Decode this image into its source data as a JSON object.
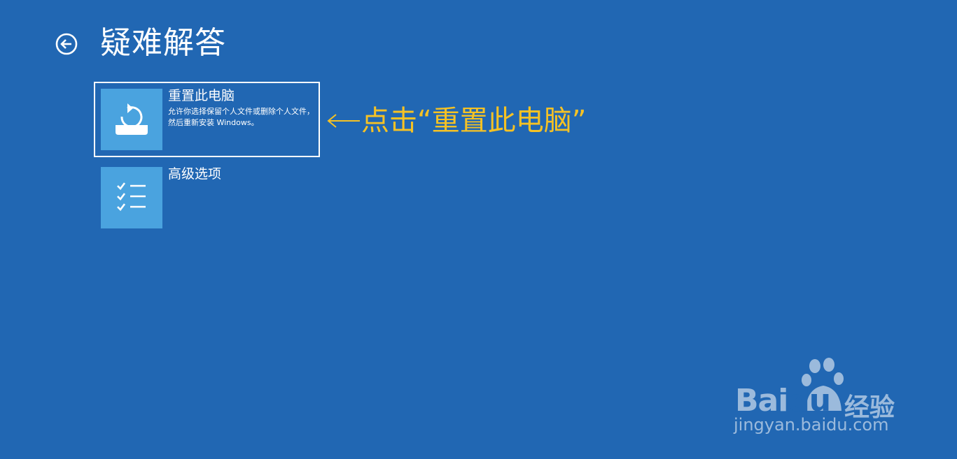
{
  "header": {
    "title": "疑难解答",
    "back_icon": "back-arrow-icon"
  },
  "options": [
    {
      "title": "重置此电脑",
      "description": "允许你选择保留个人文件或删除个人文件，然后重新安装 Windows。",
      "icon": "reset-pc-icon",
      "selected": true
    },
    {
      "title": "高级选项",
      "description": "",
      "icon": "checklist-icon",
      "selected": false
    }
  ],
  "annotation": {
    "text": "点击“重置此电脑”",
    "color": "#f6c224"
  },
  "watermark": {
    "url": "jingyan.baidu.com"
  },
  "colors": {
    "background": "#2167b3",
    "tile": "#4aa3df",
    "accent": "#f6c224"
  }
}
